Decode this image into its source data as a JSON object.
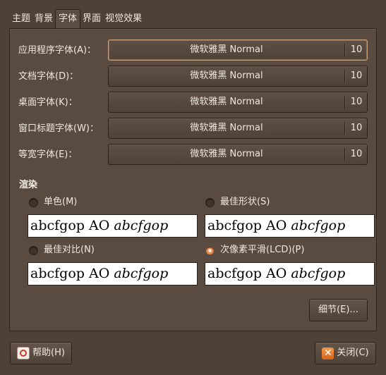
{
  "tabs": [
    {
      "label": "主题"
    },
    {
      "label": "背景"
    },
    {
      "label": "字体"
    },
    {
      "label": "界面"
    },
    {
      "label": "视觉效果"
    }
  ],
  "fonts": [
    {
      "label": "应用程序字体(A)：",
      "name": "微软雅黑 Normal",
      "size": "10"
    },
    {
      "label": "文档字体(D)：",
      "name": "微软雅黑 Normal",
      "size": "10"
    },
    {
      "label": "桌面字体(K)：",
      "name": "微软雅黑 Normal",
      "size": "10"
    },
    {
      "label": "窗口标题字体(W)：",
      "name": "微软雅黑 Normal",
      "size": "10"
    },
    {
      "label": "等宽字体(E)：",
      "name": "微软雅黑 Normal",
      "size": "10"
    }
  ],
  "rendering": {
    "title": "渲染",
    "options": [
      {
        "label": "单色(M)",
        "selected": false
      },
      {
        "label": "最佳形状(S)",
        "selected": false
      },
      {
        "label": "最佳对比(N)",
        "selected": false
      },
      {
        "label": "次像素平滑(LCD)(P)",
        "selected": true
      }
    ],
    "sample_regular": "abcfgop AO",
    "sample_italic": "abcfgop"
  },
  "details_button": "细节(E)...",
  "help_button": "帮助(H)",
  "close_button": "关闭(C)",
  "colors": {
    "background": "#4e4238",
    "panel": "#5a4b40",
    "accent": "#e0905a"
  }
}
